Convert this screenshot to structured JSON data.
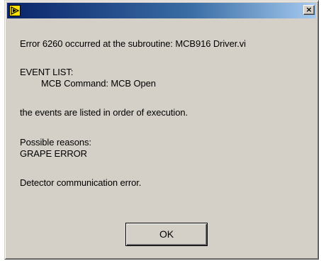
{
  "window": {
    "title": "",
    "close_label": "×"
  },
  "message": {
    "error_line": "Error 6260 occurred at the subroutine: MCB916 Driver.vi",
    "event_list_heading": "EVENT LIST:",
    "event_item": "MCB Command: MCB Open",
    "order_note": "the events are listed in order of execution.",
    "reasons_heading": "Possible reasons:",
    "reason": "GRAPE ERROR",
    "detail": "Detector communication error."
  },
  "buttons": {
    "ok_label": "OK"
  },
  "colors": {
    "titlebar_start": "#0a246a",
    "titlebar_end": "#a6caf0",
    "face": "#d4d0c8"
  }
}
